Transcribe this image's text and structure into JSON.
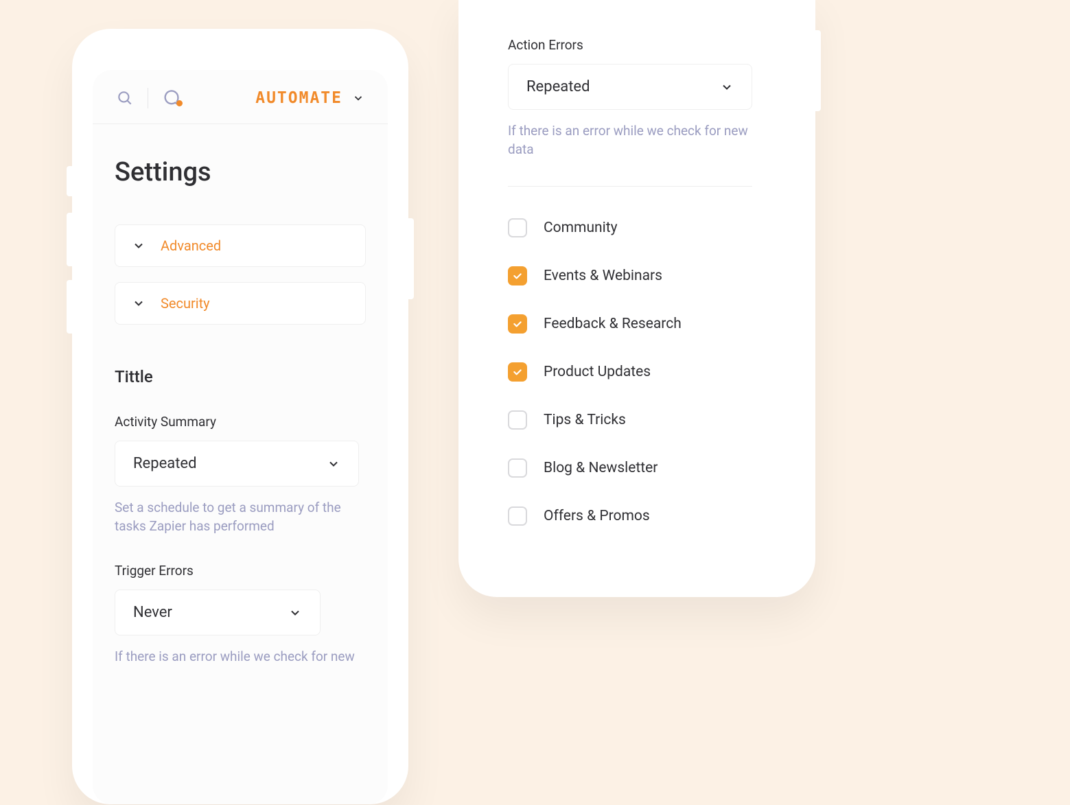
{
  "brand": "AUTOMATE",
  "left": {
    "page_title": "Settings",
    "accordions": [
      {
        "label": "Advanced"
      },
      {
        "label": "Security"
      }
    ],
    "section_title": "Tittle",
    "fields": [
      {
        "label": "Activity Summary",
        "value": "Repeated",
        "hint": "Set a schedule to get a summary of the tasks Zapier has performed"
      },
      {
        "label": "Trigger Errors",
        "value": "Never",
        "hint": "If there is an error while we check for new"
      }
    ]
  },
  "right": {
    "field": {
      "label": "Action Errors",
      "value": "Repeated",
      "hint": "If there is an error while we check for new data"
    },
    "checks": [
      {
        "label": "Community",
        "checked": false
      },
      {
        "label": "Events & Webinars",
        "checked": true
      },
      {
        "label": "Feedback & Research",
        "checked": true
      },
      {
        "label": "Product Updates",
        "checked": true
      },
      {
        "label": "Tips & Tricks",
        "checked": false
      },
      {
        "label": "Blog & Newsletter",
        "checked": false
      },
      {
        "label": "Offers & Promos",
        "checked": false
      }
    ]
  }
}
